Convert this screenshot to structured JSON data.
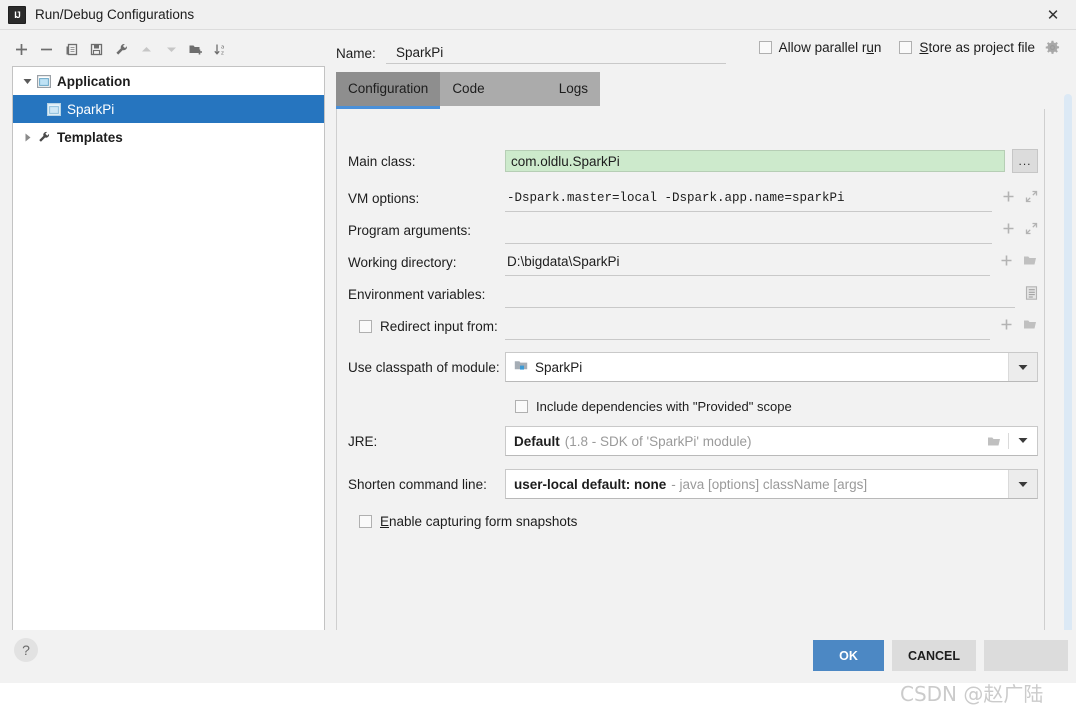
{
  "window": {
    "title": "Run/Debug Configurations",
    "app_icon": "intellij-idea-icon",
    "close_label": "✕"
  },
  "tree_toolbar": {
    "buttons": [
      {
        "name": "add-configuration-button",
        "icon": "plus-icon",
        "enabled": true
      },
      {
        "name": "remove-configuration-button",
        "icon": "minus-icon",
        "enabled": true
      },
      {
        "name": "copy-configuration-button",
        "icon": "copy-icon",
        "enabled": true
      },
      {
        "name": "save-configuration-button",
        "icon": "save-icon",
        "enabled": true
      },
      {
        "name": "edit-templates-button",
        "icon": "wrench-icon",
        "enabled": true
      },
      {
        "name": "move-up-button",
        "icon": "arrow-up-icon",
        "enabled": false
      },
      {
        "name": "move-down-button",
        "icon": "arrow-down-icon",
        "enabled": false
      },
      {
        "name": "new-folder-button",
        "icon": "new-folder-icon",
        "enabled": true
      },
      {
        "name": "sort-configurations-button",
        "icon": "sort-alpha-icon",
        "enabled": true
      }
    ]
  },
  "tree": {
    "nodes": [
      {
        "label": "Application",
        "icon": "application-icon",
        "twisty": "expanded",
        "selected": false,
        "depth": 0
      },
      {
        "label": "SparkPi",
        "icon": "run-config-icon",
        "twisty": "none",
        "selected": true,
        "depth": 1
      },
      {
        "label": "Templates",
        "icon": "wrench-icon",
        "twisty": "collapsed",
        "selected": false,
        "depth": 0
      }
    ]
  },
  "name_row": {
    "label": "Name:",
    "value": "SparkPi",
    "placeholder": "Name"
  },
  "top_options": {
    "allow_parallel_run": {
      "label_pre": "Allow parallel r",
      "label_underline": "u",
      "label_post": "n",
      "checked": false
    },
    "store_as_project_file": {
      "label_underline": "S",
      "label_post": "tore as project file",
      "checked": false
    },
    "gear_icon": "gear-icon"
  },
  "tabs": [
    {
      "label": "Configuration",
      "active": true
    },
    {
      "label": "Code Coverage",
      "active": false
    },
    {
      "label": "Logs",
      "active": false
    }
  ],
  "form": {
    "main_class": {
      "label": "Main class:",
      "value": "com.oldlu.SparkPi",
      "browse_button": "...",
      "highlight_color": "#cdeacc"
    },
    "vm_options": {
      "label": "VM options:",
      "value": "-Dspark.master=local -Dspark.app.name=sparkPi",
      "icons": [
        "plus-icon",
        "expand-icon"
      ]
    },
    "program_arguments": {
      "label": "Program arguments:",
      "value": "",
      "icons": [
        "plus-icon",
        "expand-icon"
      ]
    },
    "working_directory": {
      "label": "Working directory:",
      "value": "D:\\bigdata\\SparkPi",
      "icons": [
        "plus-icon",
        "folder-icon"
      ]
    },
    "environment_variables": {
      "label": "Environment variables:",
      "value": "",
      "icons": [
        "list-icon"
      ]
    },
    "redirect_input": {
      "label": "Redirect input from:",
      "checked": false,
      "value": "",
      "icons": [
        "plus-icon",
        "folder-icon"
      ]
    },
    "use_classpath_of_module": {
      "label": "Use classpath of module:",
      "value": "SparkPi",
      "value_icon": "module-icon",
      "arrow": "chevron-down-icon"
    },
    "include_provided": {
      "label": "Include dependencies with \"Provided\" scope",
      "checked": false
    },
    "jre": {
      "label": "JRE:",
      "value_bold": "Default",
      "value_muted": "(1.8 - SDK of 'SparkPi' module)",
      "icons": [
        "folder-icon",
        "chevron-down-icon"
      ]
    },
    "shorten_command_line": {
      "label": "Shorten command line:",
      "value_bold": "user-local default: none",
      "value_muted": "- java [options] className [args]",
      "arrow": "chevron-down-icon"
    },
    "enable_capturing": {
      "label_underline": "E",
      "label_post": "nable capturing form snapshots",
      "checked": false
    }
  },
  "bottom_bar": {
    "help_label": "?",
    "ok_label": "OK",
    "cancel_label": "CANCEL",
    "apply_label": ""
  },
  "watermark": {
    "text": "CSDN @赵广陆"
  },
  "colors": {
    "selection_blue": "#2675bf",
    "accent_blue": "#4a90d9",
    "ok_button_blue": "#4c88c4",
    "panel_bg": "#f2f2f2",
    "field_green": "#cdeacc",
    "tab_bar_gray": "#ababab"
  }
}
